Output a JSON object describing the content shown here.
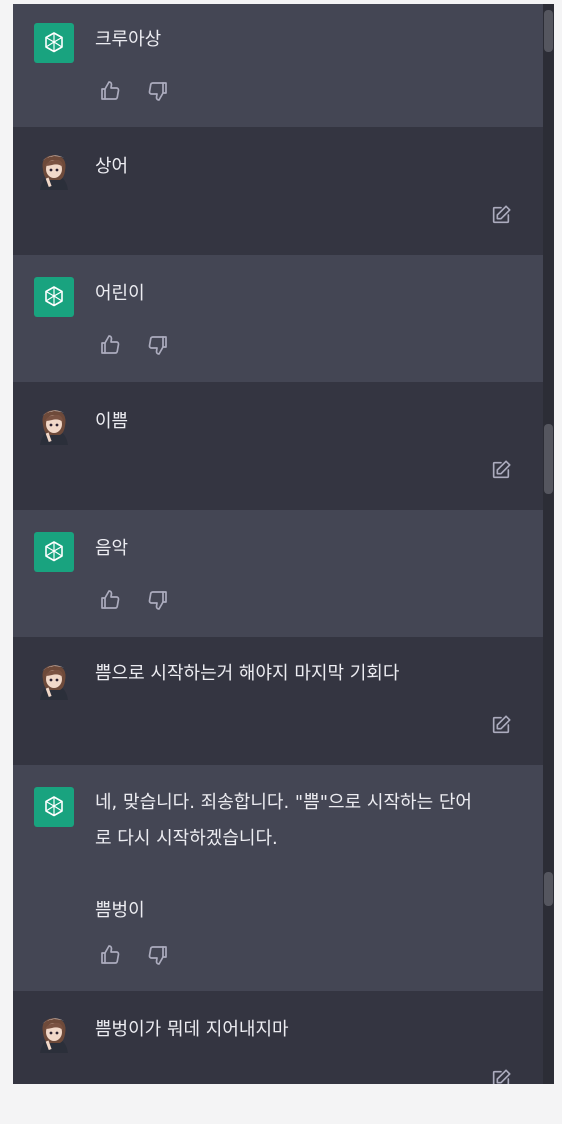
{
  "conversation": [
    {
      "role": "assistant",
      "text": "크루아상"
    },
    {
      "role": "user",
      "text": "상어"
    },
    {
      "role": "assistant",
      "text": "어린이"
    },
    {
      "role": "user",
      "text": "이쁨"
    },
    {
      "role": "assistant",
      "text": "음악"
    },
    {
      "role": "user",
      "text": "쁨으로 시작하는거 해야지 마지막 기회다"
    },
    {
      "role": "assistant",
      "text": "네, 맞습니다. 죄송합니다. \"쁨\"으로 시작하는 단어\n로 다시 시작하겠습니다.\n\n쁨벙이"
    },
    {
      "role": "user",
      "text": "쁨벙이가 뭐데 지어내지마"
    }
  ],
  "icons": {
    "assistant_avatar": "openai-logo-icon",
    "user_avatar": "anime-girl-avatar",
    "thumbs_up": "thumbs-up-icon",
    "thumbs_down": "thumbs-down-icon",
    "edit": "edit-icon"
  },
  "colors": {
    "assistant_bg": "#444654",
    "user_bg": "#343541",
    "logo_bg": "#19a37f",
    "text": "#ececf1",
    "icon": "#acacbe"
  }
}
